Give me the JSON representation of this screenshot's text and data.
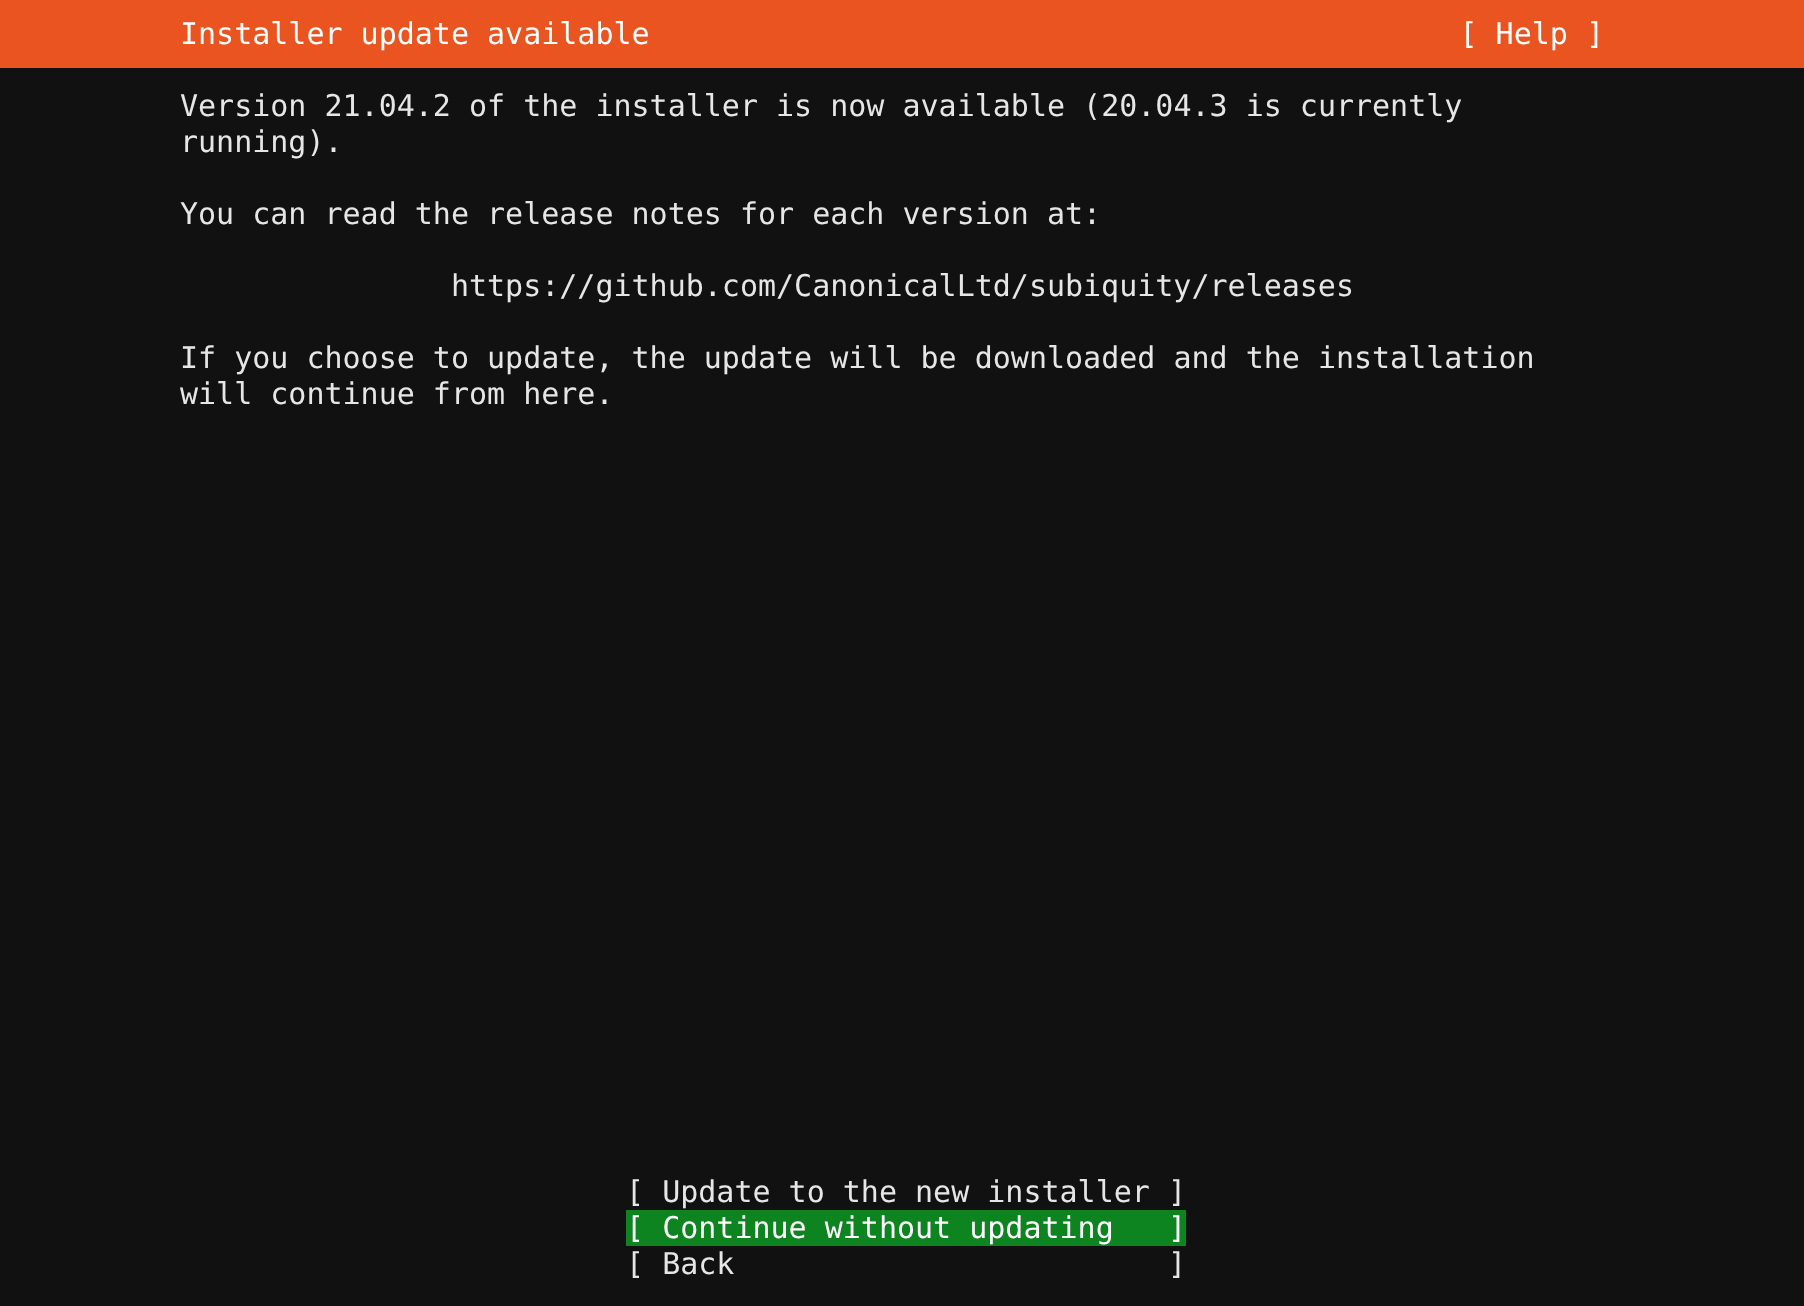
{
  "header": {
    "title": "Installer update available",
    "help": "[ Help ]"
  },
  "paragraphs": [
    {
      "kind": "text",
      "text": "Version 21.04.2 of the installer is now available (20.04.3 is currently running)."
    },
    {
      "kind": "text",
      "text": "You can read the release notes for each version at:"
    },
    {
      "kind": "url",
      "text": "https://github.com/CanonicalLtd/subiquity/releases"
    },
    {
      "kind": "text",
      "text": "If you choose to update, the update will be downloaded and the installation will continue from here."
    }
  ],
  "buttons": [
    {
      "open": "[",
      "label": "Update to the new installer",
      "close": "]",
      "selected": false
    },
    {
      "open": "[",
      "label": "Continue without updating",
      "close": "]",
      "selected": true
    },
    {
      "open": "[",
      "label": "Back",
      "close": "]",
      "selected": false
    }
  ]
}
